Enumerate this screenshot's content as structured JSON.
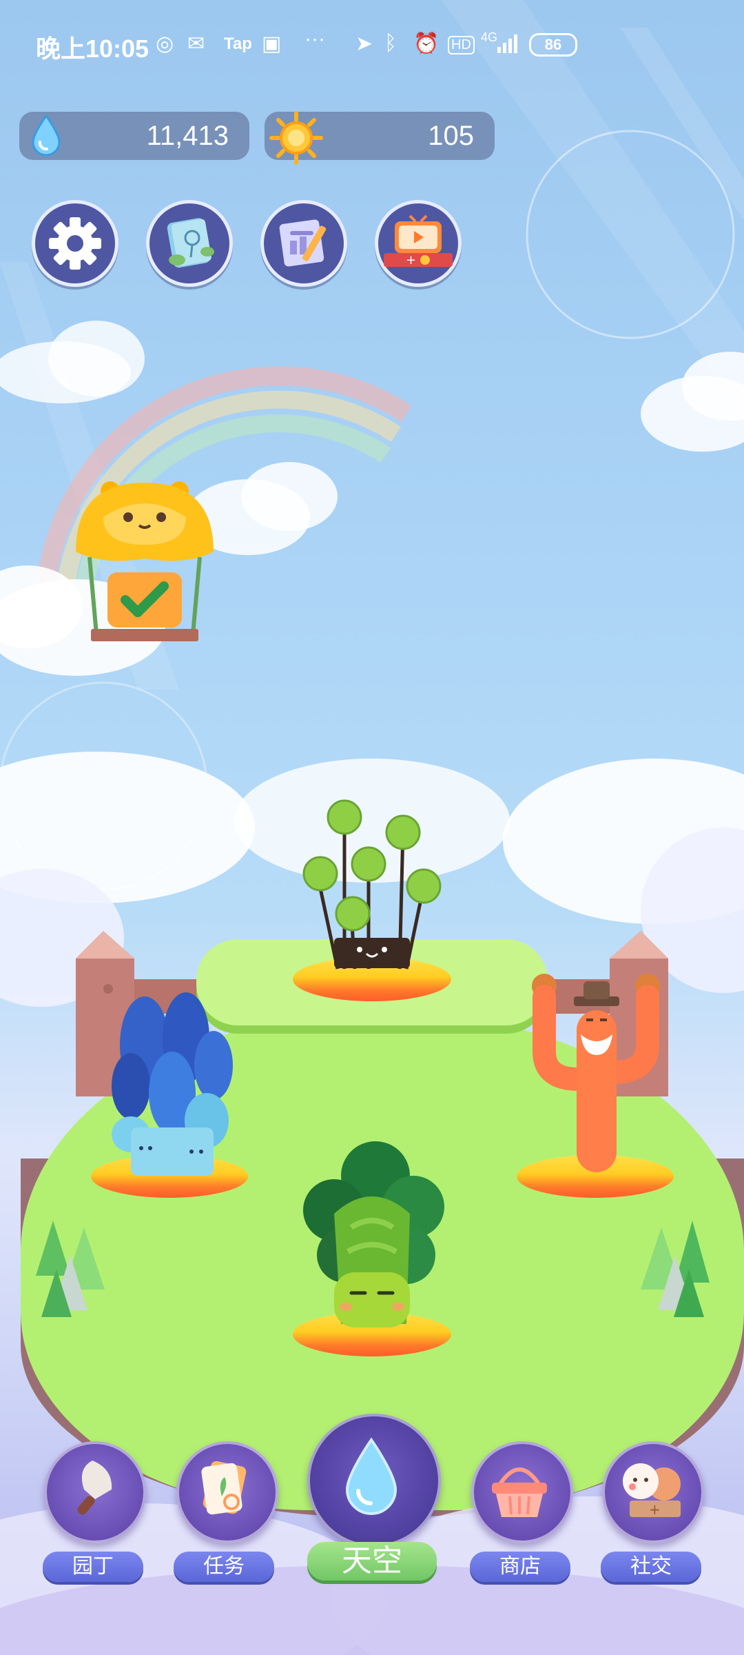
{
  "status_bar": {
    "time": "晚上10:05",
    "tap_label": "Tap",
    "more": "···",
    "hd": "HD",
    "network": "4G",
    "battery": "86"
  },
  "resources": {
    "water": {
      "icon": "water-drop-icon",
      "value": "11,413"
    },
    "sun": {
      "icon": "sun-icon",
      "value": "105"
    }
  },
  "top_buttons": [
    {
      "name": "settings",
      "icon": "gear-icon"
    },
    {
      "name": "plant-book",
      "icon": "plant-book-icon"
    },
    {
      "name": "tasks-sheet",
      "icon": "notepad-pencil-icon"
    },
    {
      "name": "watch-video-reward",
      "icon": "tv-video-reward-icon"
    }
  ],
  "bottom_nav": [
    {
      "label": "园丁",
      "icon": "trowel-icon",
      "active": false
    },
    {
      "label": "任务",
      "icon": "task-cards-icon",
      "active": false
    },
    {
      "label": "天空",
      "icon": "water-drop-icon",
      "active": true
    },
    {
      "label": "商店",
      "icon": "basket-icon",
      "active": false
    },
    {
      "label": "社交",
      "icon": "friends-icon",
      "active": false
    }
  ],
  "colors": {
    "sky_top": "#9cc7ef",
    "grass": "#b3f071",
    "nav_label": "#6b77e4",
    "nav_active": "#8fd67a",
    "resource_pill": "#5f6e96"
  }
}
